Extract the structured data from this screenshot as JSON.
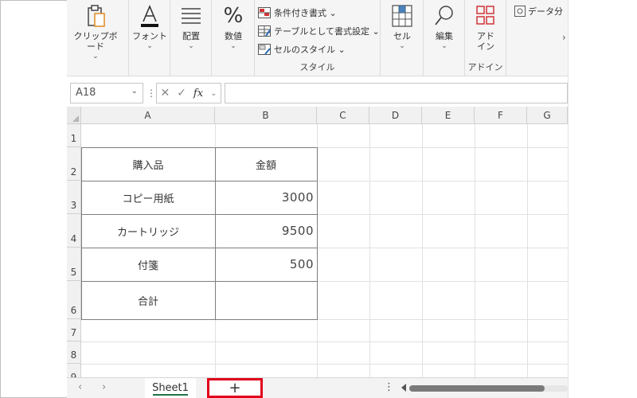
{
  "ribbon": {
    "clipboard": {
      "label": "クリップボード",
      "chev": "⌄"
    },
    "font": {
      "label": "フォント",
      "chev": "⌄"
    },
    "alignment": {
      "label": "配置",
      "chev": "⌄"
    },
    "number": {
      "label": "数値",
      "chev": "⌄",
      "icon_text": "%"
    },
    "styles": {
      "conditional": "条件付き書式 ⌄",
      "as_table": "テーブルとして書式設定 ⌄",
      "cell_styles": "セルのスタイル ⌄",
      "group_label": "スタイル"
    },
    "cells": {
      "label": "セル",
      "chev": "⌄"
    },
    "editing": {
      "label": "編集",
      "chev": "⌄"
    },
    "addins": {
      "btn_line1": "アド",
      "btn_line2": "イン",
      "group_label": "アドイン"
    },
    "data_partial": "データ分",
    "more_arrow": "›"
  },
  "formula_bar": {
    "name_box": "A18",
    "name_dd": "⌄",
    "sep": "⋮",
    "cancel": "✕",
    "enter": "✓",
    "fx": "fx",
    "fx_dd": "⌄",
    "value": ""
  },
  "columns": [
    "A",
    "B",
    "C",
    "D",
    "E",
    "F",
    "G"
  ],
  "rows": [
    "1",
    "2",
    "3",
    "4",
    "5",
    "6",
    "7",
    "8",
    "9"
  ],
  "table": {
    "header": {
      "item": "購入品",
      "amount": "金額"
    },
    "rows": [
      {
        "item": "コピー用紙",
        "amount": "3000"
      },
      {
        "item": "カートリッジ",
        "amount": "9500"
      },
      {
        "item": "付箋",
        "amount": "500"
      },
      {
        "item": "合計",
        "amount": ""
      }
    ]
  },
  "sheetbar": {
    "prev": "‹",
    "next": "›",
    "sheet_name": "Sheet1",
    "add": "+",
    "dots": "⋮"
  },
  "colors": {
    "highlight": "#e0001a",
    "accent_green": "#217346"
  }
}
